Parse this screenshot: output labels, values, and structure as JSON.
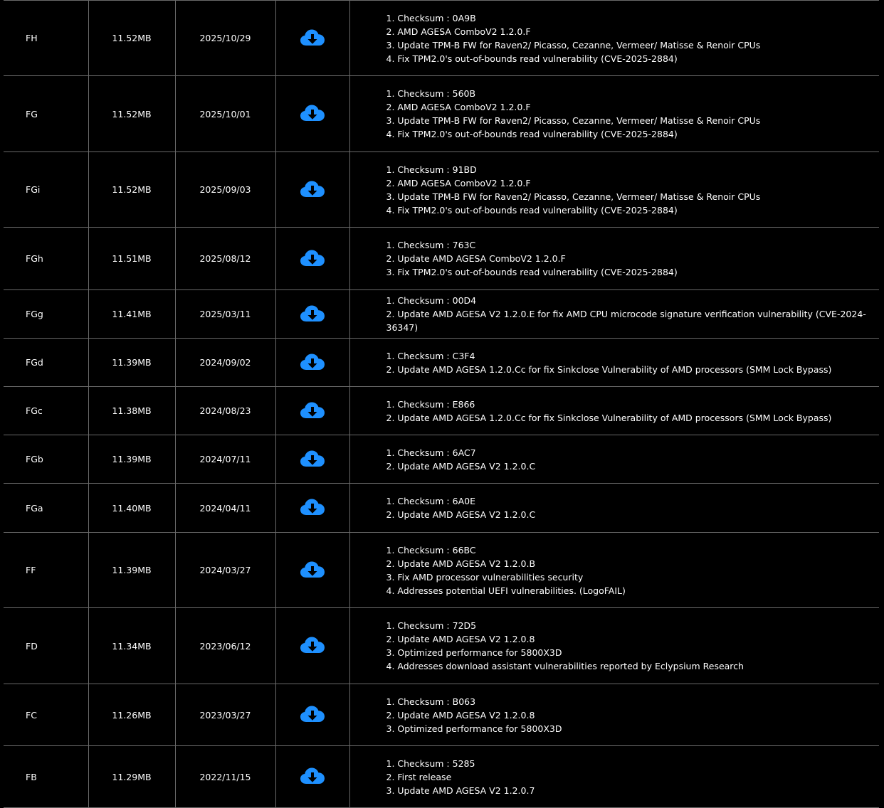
{
  "theme": {
    "background": "#000000",
    "text": "#ffffff",
    "grid": "#6a6a6a",
    "accent": "#1e90ff"
  },
  "download_icon": "cloud-download-icon",
  "rows": [
    {
      "version": "FH",
      "size": "11.52MB",
      "date": "2025/10/29",
      "notes": [
        "1. Checksum : 0A9B",
        "2. AMD AGESA ComboV2 1.2.0.F",
        "3. Update TPM-B FW for Raven2/ Picasso, Cezanne, Vermeer/ Matisse & Renoir CPUs",
        "4. Fix TPM2.0's out-of-bounds read vulnerability (CVE-2025-2884)"
      ]
    },
    {
      "version": "FG",
      "size": "11.52MB",
      "date": "2025/10/01",
      "notes": [
        "1. Checksum : 560B",
        "2. AMD AGESA ComboV2 1.2.0.F",
        "3. Update TPM-B FW for Raven2/ Picasso, Cezanne, Vermeer/ Matisse & Renoir CPUs",
        "4. Fix TPM2.0's out-of-bounds read vulnerability (CVE-2025-2884)"
      ]
    },
    {
      "version": "FGi",
      "size": "11.52MB",
      "date": "2025/09/03",
      "notes": [
        "1. Checksum : 91BD",
        "2. AMD AGESA ComboV2 1.2.0.F",
        "3. Update TPM-B FW for Raven2/ Picasso, Cezanne, Vermeer/ Matisse & Renoir CPUs",
        "4. Fix TPM2.0's out-of-bounds read vulnerability (CVE-2025-2884)"
      ]
    },
    {
      "version": "FGh",
      "size": "11.51MB",
      "date": "2025/08/12",
      "notes": [
        "1. Checksum : 763C",
        "2. Update AMD AGESA ComboV2 1.2.0.F",
        "3. Fix TPM2.0's out-of-bounds read vulnerability (CVE-2025-2884)"
      ]
    },
    {
      "version": "FGg",
      "size": "11.41MB",
      "date": "2025/03/11",
      "notes": [
        "1. Checksum : 00D4",
        "2. Update AMD AGESA V2 1.2.0.E for fix AMD CPU microcode signature verification vulnerability (CVE-2024-36347)"
      ]
    },
    {
      "version": "FGd",
      "size": "11.39MB",
      "date": "2024/09/02",
      "notes": [
        "1. Checksum : C3F4",
        "2. Update AMD AGESA 1.2.0.Cc for fix Sinkclose Vulnerability of AMD processors (SMM Lock Bypass)"
      ]
    },
    {
      "version": "FGc",
      "size": "11.38MB",
      "date": "2024/08/23",
      "notes": [
        "1. Checksum : E866",
        "2. Update AMD AGESA 1.2.0.Cc for fix Sinkclose Vulnerability of AMD processors (SMM Lock Bypass)"
      ]
    },
    {
      "version": "FGb",
      "size": "11.39MB",
      "date": "2024/07/11",
      "notes": [
        "1. Checksum : 6AC7",
        "2. Update AMD AGESA V2 1.2.0.C"
      ]
    },
    {
      "version": "FGa",
      "size": "11.40MB",
      "date": "2024/04/11",
      "notes": [
        "1. Checksum : 6A0E",
        "2. Update AMD AGESA V2 1.2.0.C"
      ]
    },
    {
      "version": "FF",
      "size": "11.39MB",
      "date": "2024/03/27",
      "notes": [
        "1. Checksum : 66BC",
        "2. Update AMD AGESA V2 1.2.0.B",
        "3. Fix AMD processor vulnerabilities security",
        "4. Addresses potential UEFI vulnerabilities. (LogoFAIL)"
      ]
    },
    {
      "version": "FD",
      "size": "11.34MB",
      "date": "2023/06/12",
      "notes": [
        "1. Checksum : 72D5",
        "2. Update AMD AGESA V2 1.2.0.8",
        "3. Optimized performance for 5800X3D",
        "4. Addresses download assistant vulnerabilities reported by Eclypsium Research"
      ]
    },
    {
      "version": "FC",
      "size": "11.26MB",
      "date": "2023/03/27",
      "notes": [
        "1. Checksum : B063",
        "2. Update AMD AGESA V2 1.2.0.8",
        "3. Optimized performance for 5800X3D"
      ]
    },
    {
      "version": "FB",
      "size": "11.29MB",
      "date": "2022/11/15",
      "notes": [
        "1. Checksum : 5285",
        "2. First release",
        "3. Update AMD AGESA V2 1.2.0.7"
      ]
    }
  ]
}
